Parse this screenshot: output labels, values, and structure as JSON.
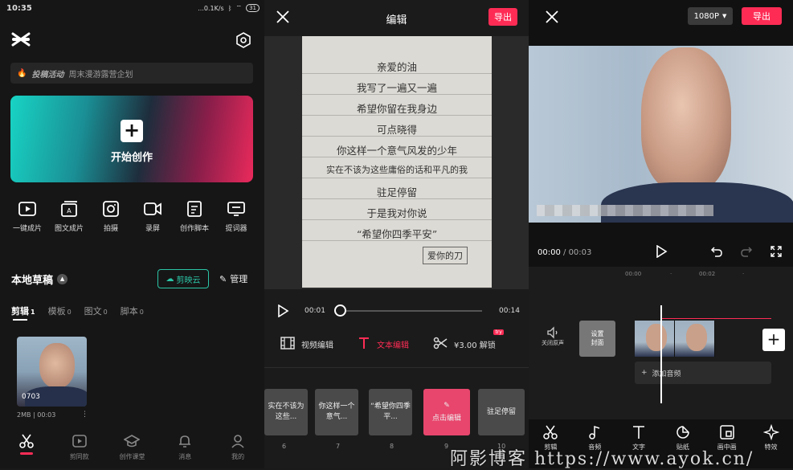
{
  "status": {
    "time": "10:35",
    "net": "...0.1K/s",
    "battery": "31"
  },
  "home": {
    "banner_tag": "投稿活动",
    "banner_text": "周末漫游露营企划",
    "create_label": "开始创作",
    "tools": [
      {
        "label": "一键成片",
        "icon": "play-box-icon"
      },
      {
        "label": "图文成片",
        "icon": "text-image-icon"
      },
      {
        "label": "拍摄",
        "icon": "camera-icon"
      },
      {
        "label": "录屏",
        "icon": "record-screen-icon"
      },
      {
        "label": "创作脚本",
        "icon": "script-icon"
      },
      {
        "label": "提词器",
        "icon": "teleprompter-icon"
      }
    ],
    "drafts_title": "本地草稿",
    "cloud_label": "剪映云",
    "manage_label": "管理",
    "tabs": [
      {
        "label": "剪辑",
        "count": "1"
      },
      {
        "label": "模板",
        "count": "0"
      },
      {
        "label": "图文",
        "count": "0"
      },
      {
        "label": "脚本",
        "count": "0"
      }
    ],
    "draft": {
      "duration": "0703",
      "meta": "2MB | 00:03",
      "more": "⋮"
    },
    "nav": [
      {
        "label": "",
        "icon": "scissors-icon"
      },
      {
        "label": "剪同款",
        "icon": "template-icon"
      },
      {
        "label": "创作课堂",
        "icon": "graduation-cap-icon"
      },
      {
        "label": "消息",
        "icon": "bell-icon"
      },
      {
        "label": "我的",
        "icon": "profile-icon"
      }
    ]
  },
  "editor": {
    "title": "编辑",
    "export_label": "导出",
    "poem": [
      "亲爱的油",
      "我写了一遍又一遍",
      "希望你留在我身边",
      "可点晓得",
      "你这样一个意气风发的少年",
      "实在不该为这些庸俗的话和平凡的我",
      "驻足停留",
      "于是我对你说",
      "“希望你四季平安”"
    ],
    "signature": "爱你的刀",
    "time_current": "00:01",
    "time_total": "00:14",
    "progress": 0.0,
    "actions": [
      {
        "label": "视频编辑",
        "icon": "film-icon"
      },
      {
        "label": "文本编辑",
        "icon": "text-t-icon"
      },
      {
        "label": "¥3.00 解锁",
        "icon": "scissors-icon",
        "badge": "try"
      }
    ],
    "clips": [
      {
        "text": "实在不该为这些...",
        "num": "6"
      },
      {
        "text": "你这样一个意气...",
        "num": "7"
      },
      {
        "text": "“希望你四季平...",
        "num": "8"
      },
      {
        "text": "点击编辑",
        "num": "9"
      },
      {
        "text": "驻足停留",
        "num": "10"
      }
    ]
  },
  "video": {
    "resolution": "1080P",
    "export_label": "导出",
    "time_current": "00:00",
    "time_total": "/ 00:03",
    "ruler": [
      "00:00",
      "·",
      "00:02",
      "·"
    ],
    "mute_label": "关闭原声",
    "cover_label": "设置\n封面",
    "add_audio_label": "添加音频",
    "tools": [
      {
        "label": "剪辑",
        "icon": "scissors-icon"
      },
      {
        "label": "音频",
        "icon": "music-note-icon"
      },
      {
        "label": "文字",
        "icon": "text-t-icon"
      },
      {
        "label": "贴纸",
        "icon": "sticker-icon"
      },
      {
        "label": "画中画",
        "icon": "picture-in-picture-icon"
      },
      {
        "label": "特效",
        "icon": "sparkle-icon"
      }
    ]
  },
  "watermark": "阿影博客 https://www.ayok.cn/",
  "colors": {
    "accent": "#fe2c55",
    "cloud": "#2bc5a6"
  }
}
